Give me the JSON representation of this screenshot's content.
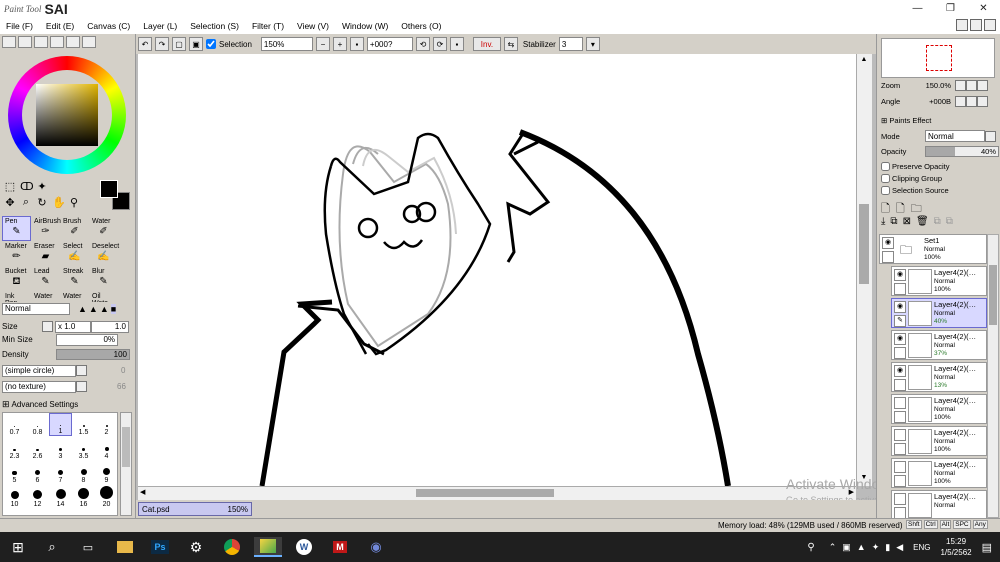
{
  "app": {
    "brand_small": "Paint Tool",
    "brand_big": "SAI"
  },
  "window": {
    "min": "—",
    "restore": "❐",
    "close": "✕"
  },
  "menu": [
    "File (F)",
    "Edit (E)",
    "Canvas (C)",
    "Layer (L)",
    "Selection (S)",
    "Filter (T)",
    "View (V)",
    "Window (W)",
    "Others (O)"
  ],
  "toolbar": {
    "selection_label": "Selection",
    "zoom": "150%",
    "angle": "+000?",
    "inv": "Inv.",
    "stabilizer_label": "Stabilizer",
    "stabilizer_value": "3"
  },
  "tools": [
    {
      "label": "Pen",
      "icon": "pen-icon"
    },
    {
      "label": "AirBrush",
      "icon": "airbrush-icon"
    },
    {
      "label": "Brush",
      "icon": "brush-icon"
    },
    {
      "label": "Water",
      "icon": "water-icon"
    },
    {
      "label": "Marker",
      "icon": "marker-icon"
    },
    {
      "label": "Eraser",
      "icon": "eraser-icon"
    },
    {
      "label": "Select",
      "icon": "select-icon"
    },
    {
      "label": "Deselect",
      "icon": "deselect-icon"
    },
    {
      "label": "Bucket",
      "icon": "bucket-icon"
    },
    {
      "label": "Lead",
      "icon": "lead-icon"
    },
    {
      "label": "Streak",
      "icon": "streak-icon"
    },
    {
      "label": "Blur",
      "icon": "blur-icon"
    },
    {
      "label": "Ink Pen",
      "icon": "inkpen-icon"
    },
    {
      "label": "Water",
      "icon": "water-icon"
    },
    {
      "label": "Water",
      "icon": "water-icon"
    },
    {
      "label": "Oil Wate",
      "icon": "oilwater-icon"
    }
  ],
  "brush": {
    "mode": "Normal",
    "size_label": "Size",
    "size_mult": "x 1.0",
    "size_value": "1.0",
    "minsize_label": "Min Size",
    "minsize_value": "0%",
    "density_label": "Density",
    "density_value": "100",
    "shape": "(simple circle)",
    "shape_value": "0",
    "texture": "(no texture)",
    "texture_value": "66",
    "advanced": "Advanced Settings"
  },
  "brush_sizes": [
    "0.7",
    "0.8",
    "1",
    "1.5",
    "2",
    "2.3",
    "2.6",
    "3",
    "3.5",
    "4",
    "5",
    "6",
    "7",
    "8",
    "9",
    "10",
    "12",
    "14",
    "16",
    "20"
  ],
  "right": {
    "zoom_label": "Zoom",
    "zoom_value": "150.0%",
    "angle_label": "Angle",
    "angle_value": "+000B",
    "paints_effect": "Paints Effect",
    "mode_label": "Mode",
    "mode_value": "Normal",
    "opacity_label": "Opacity",
    "opacity_value": "40%",
    "preserve_opacity": "Preserve Opacity",
    "clipping_group": "Clipping Group",
    "selection_source": "Selection Source"
  },
  "set": {
    "name": "Set1",
    "mode": "Normal",
    "opacity": "100%"
  },
  "layers": [
    {
      "name": "Layer4(2)(…",
      "mode": "Normal",
      "opacity": "100%",
      "visible": true,
      "selected": false
    },
    {
      "name": "Layer4(2)(…",
      "mode": "Normal",
      "opacity": "40%",
      "visible": true,
      "selected": true
    },
    {
      "name": "Layer4(2)(…",
      "mode": "Normal",
      "opacity": "37%",
      "visible": true,
      "selected": false
    },
    {
      "name": "Layer4(2)(…",
      "mode": "Normal",
      "opacity": "13%",
      "visible": true,
      "selected": false
    },
    {
      "name": "Layer4(2)(…",
      "mode": "Normal",
      "opacity": "100%",
      "visible": false,
      "selected": false
    },
    {
      "name": "Layer4(2)(…",
      "mode": "Normal",
      "opacity": "100%",
      "visible": false,
      "selected": false
    },
    {
      "name": "Layer4(2)(…",
      "mode": "Normal",
      "opacity": "100%",
      "visible": false,
      "selected": false
    },
    {
      "name": "Layer4(2)(…",
      "mode": "Normal",
      "opacity": "",
      "visible": false,
      "selected": false
    }
  ],
  "document": {
    "tab_name": "Cat.psd",
    "tab_zoom": "150%"
  },
  "status": {
    "memory": "Memory load: 48% (129MB used / 860MB reserved)",
    "keys": [
      "Shft",
      "Ctrl",
      "Alt",
      "SPC",
      "Any"
    ]
  },
  "watermark": {
    "line1": "Activate Windows",
    "line2": "Go to Settings to activate Windows."
  },
  "taskbar": {
    "time": "15:29",
    "date": "1/5/2562",
    "lang": "ENG",
    "ps_label": "Ps",
    "word_label": "W",
    "mcafee_label": "M"
  }
}
